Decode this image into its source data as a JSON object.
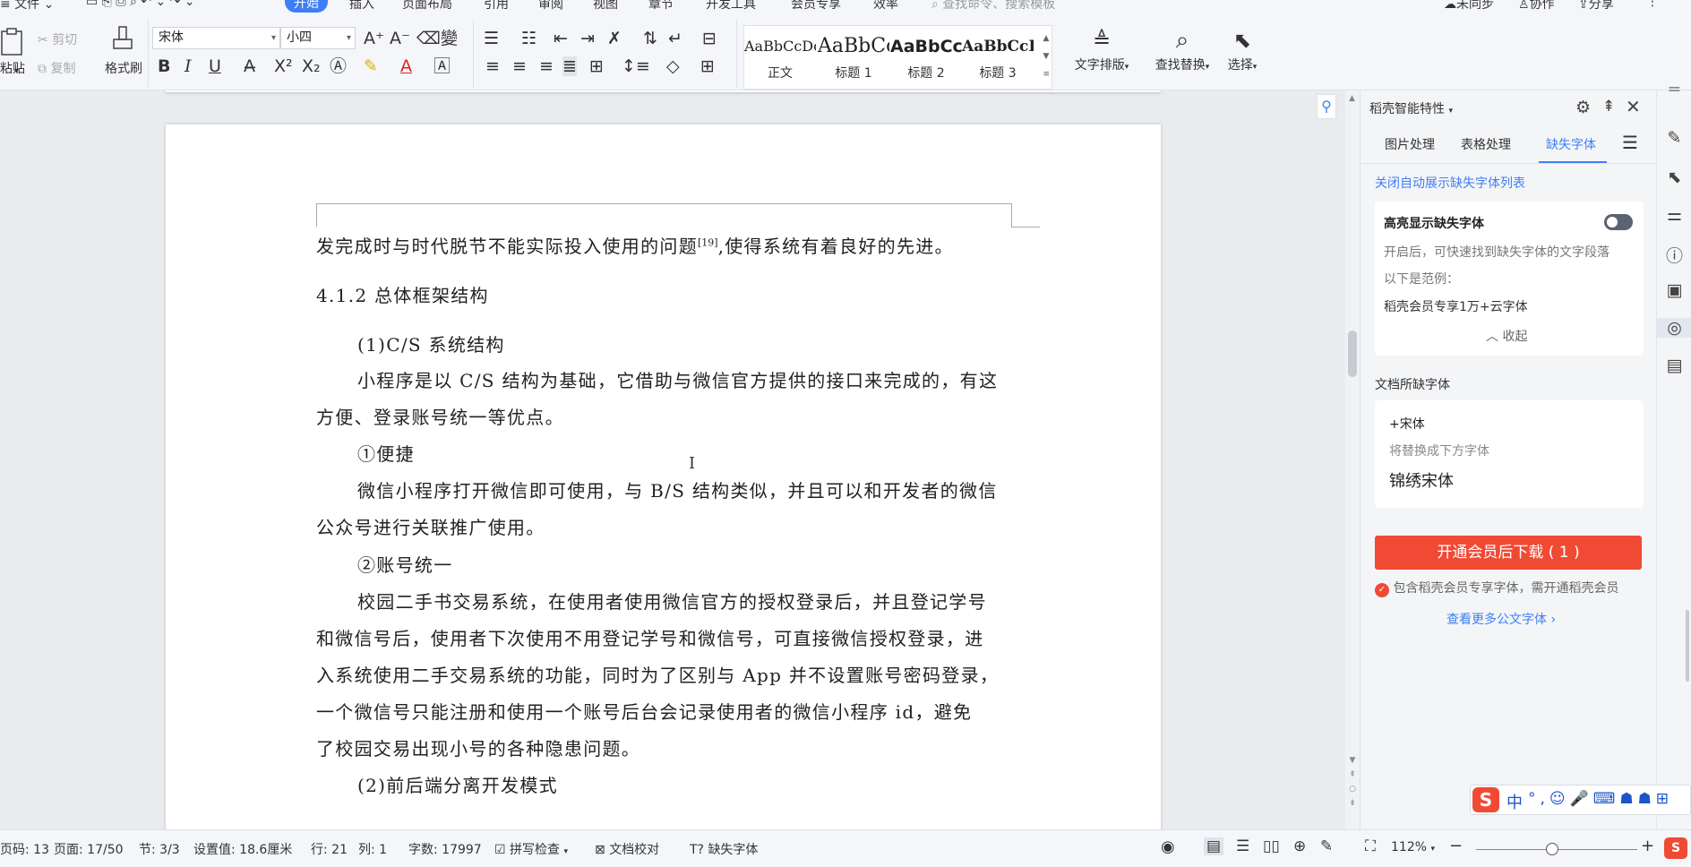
{
  "menubar": {
    "file_label": "文件",
    "tabs": [
      "开始",
      "插入",
      "页面布局",
      "引用",
      "审阅",
      "视图",
      "章节",
      "开发工具",
      "会员专享",
      "效率"
    ],
    "search_placeholder": "查找命令、搜索模板",
    "sync_label": "未同步",
    "collab_label": "协作",
    "share_label": "分享"
  },
  "ribbon": {
    "paste_label": "粘贴",
    "cut_label": "剪切",
    "copy_label": "复制",
    "format_painter_label": "格式刷",
    "font_name": "宋体",
    "font_size": "小四",
    "styles": [
      {
        "sample": "AaBbCcDc",
        "name": "正文"
      },
      {
        "sample": "AaBbCc",
        "name": "标题 1"
      },
      {
        "sample": "AaBbCcI",
        "name": "标题 2"
      },
      {
        "sample": "AaBbCcDc",
        "name": "标题 3"
      }
    ],
    "text_layout_label": "文字排版",
    "find_replace_label": "查找替换",
    "select_label": "选择"
  },
  "document": {
    "lines": {
      "l1": "发完成时与时代脱节不能实际投入使用的问题",
      "l1_ref": "[19]",
      "l1_end": ",使得系统有着良好的先进。",
      "heading": "4.1.2 总体框架结构",
      "sub1": "(1)C/S 系统结构",
      "p1a": "小程序是以 C/S 结构为基础，它借助与微信官方提供的接口来完成的，有这",
      "p1b": "方便、登录账号统一等优点。",
      "item1": "①便捷",
      "p2a": "微信小程序打开微信即可使用，与 B/S 结构类似，并且可以和开发者的微信",
      "p2b": "公众号进行关联推广使用。",
      "item2": "②账号统一",
      "p3a": "校园二手书交易系统，在使用者使用微信官方的授权登录后，并且登记学号",
      "p3b": "和微信号后，使用者下次使用不用登记学号和微信号，可直接微信授权登录，进",
      "p3c": "入系统使用二手交易系统的功能，同时为了区别与 App 并不设置账号密码登录，",
      "p3d": "一个微信号只能注册和使用一个账号后台会记录使用者的微信小程序 id，避免",
      "p3e": "了校园交易出现小号的各种隐患问题。",
      "sub2": "(2)前后端分离开发模式"
    }
  },
  "panel": {
    "title": "稻壳智能特性",
    "tabs": [
      "图片处理",
      "表格处理",
      "缺失字体"
    ],
    "active_tab": "缺失字体",
    "close_auto_link": "关闭自动展示缺失字体列表",
    "highlight_label": "高亮显示缺失字体",
    "highlight_desc": "开启后，可快速找到缺失字体的文字段落",
    "example_label": "以下是范例：",
    "example_text": "稻壳会员专享1万+云字体",
    "collapse_label": "收起",
    "missing_section": "文档所缺字体",
    "missing_font": "+宋体",
    "replace_hint": "将替换成下方字体",
    "replacement_font": "锦绣宋体",
    "download_button": "开通会员后下载 ( 1 )",
    "member_note": "包含稻壳会员专享字体，需开通稻壳会员",
    "more_fonts_link": "查看更多公文字体",
    "accent_color": "#3d7ff7",
    "download_color": "#f04a35"
  },
  "statusbar": {
    "page_code": "页码: 13",
    "page": "页面: 17/50",
    "section": "节: 3/3",
    "setting": "设置值: 18.6厘米",
    "row": "行: 21",
    "col": "列: 1",
    "word_count": "字数: 17997",
    "spell_check": "拼写检查",
    "proofread": "文档校对",
    "missing_font": "缺失字体",
    "zoom": "112%"
  },
  "ime": {
    "mode": "中"
  }
}
